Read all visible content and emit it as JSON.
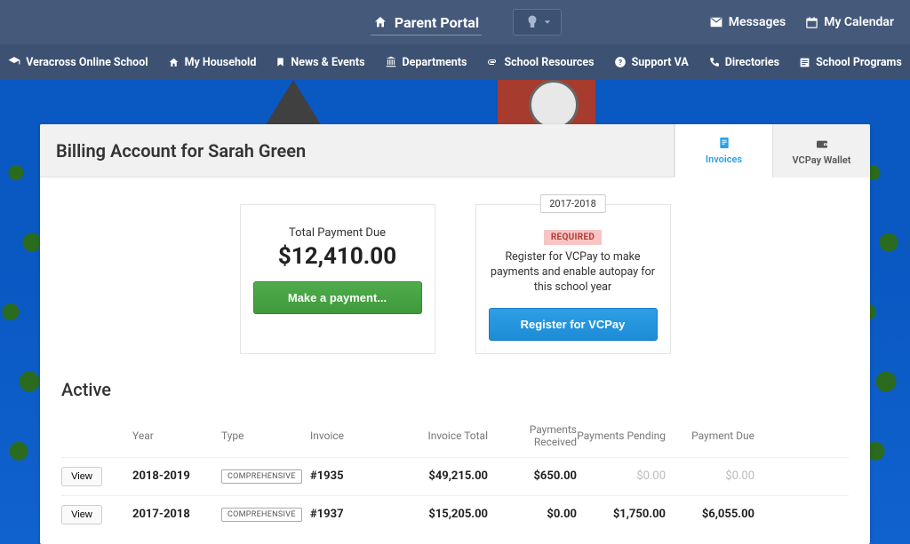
{
  "header": {
    "portal_title": "Parent Portal",
    "messages_label": "Messages",
    "calendar_label": "My Calendar"
  },
  "nav": {
    "items": [
      "Veracross Online School",
      "My Household",
      "News & Events",
      "Departments",
      "School Resources",
      "Support VA",
      "Directories",
      "School Programs"
    ]
  },
  "page": {
    "title": "Billing Account for Sarah Green",
    "tabs": {
      "invoices": "Invoices",
      "wallet": "VCPay Wallet"
    }
  },
  "summary": {
    "payment_due_label": "Total Payment Due",
    "payment_due_amount": "$12,410.00",
    "make_payment_btn": "Make a payment...",
    "year_chip": "2017-2018",
    "required_badge": "REQUIRED",
    "register_text": "Register for VCPay to make payments and enable autopay for this school year",
    "register_btn": "Register for VCPay"
  },
  "invoices": {
    "section_title": "Active",
    "view_label": "View",
    "headers": {
      "year": "Year",
      "type": "Type",
      "invoice": "Invoice",
      "total": "Invoice Total",
      "received": "Payments Received",
      "pending": "Payments Pending",
      "due": "Payment Due"
    },
    "rows": [
      {
        "year": "2018-2019",
        "type": "COMPREHENSIVE",
        "invoice": "#1935",
        "total": "$49,215.00",
        "received": "$650.00",
        "pending": "$0.00",
        "due": "$0.00",
        "due_zero": true,
        "pending_zero": true
      },
      {
        "year": "2017-2018",
        "type": "COMPREHENSIVE",
        "invoice": "#1937",
        "total": "$15,205.00",
        "received": "$0.00",
        "pending": "$1,750.00",
        "due": "$6,055.00",
        "due_zero": false,
        "pending_zero": false
      }
    ]
  }
}
